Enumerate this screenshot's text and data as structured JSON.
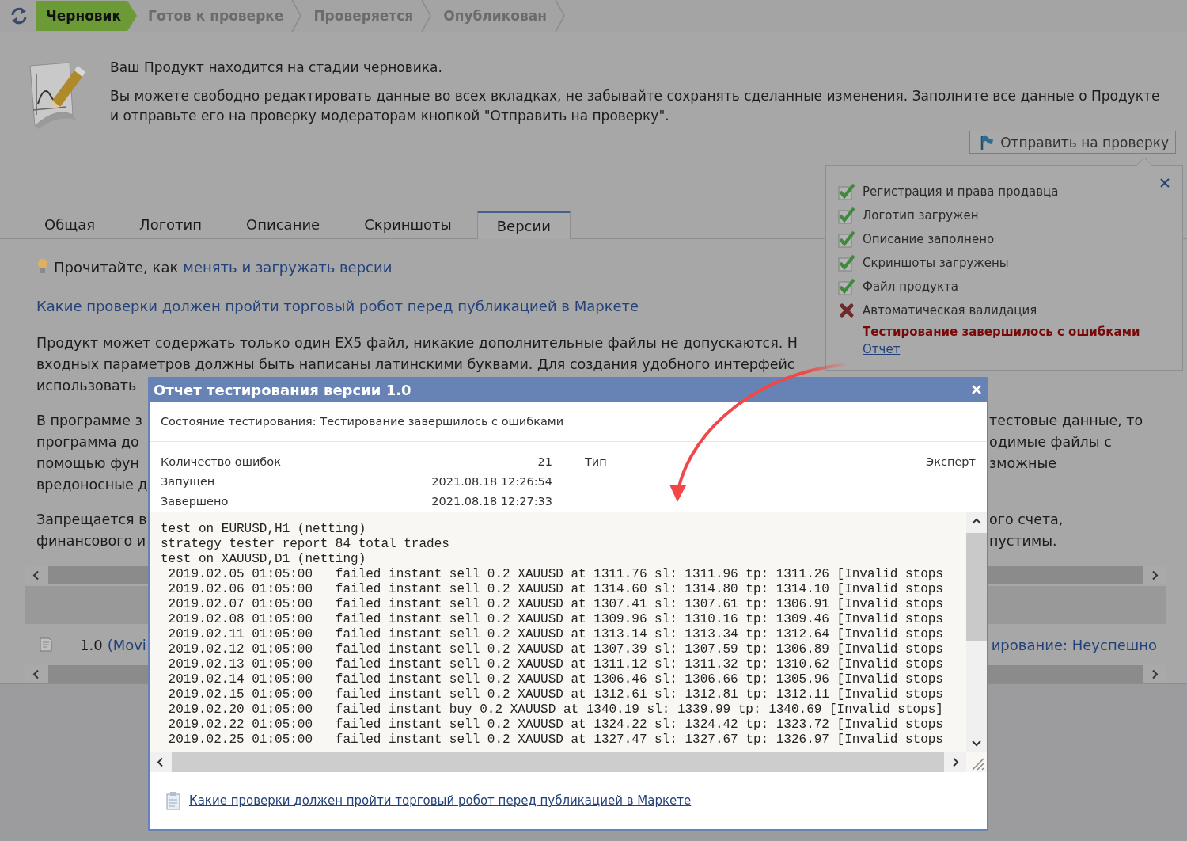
{
  "status_steps": [
    {
      "label": "Черновик",
      "selected": true
    },
    {
      "label": "Готов к проверке",
      "selected": false
    },
    {
      "label": "Проверяется",
      "selected": false
    },
    {
      "label": "Опубликован",
      "selected": false
    }
  ],
  "notice": {
    "title": "Ваш Продукт находится на стадии черновика.",
    "text": "Вы можете свободно редактировать данные во всех вкладках, не забывайте сохранять сделанные изменения. Заполните все данные о Продукте и отправьте его на проверку модераторам кнопкой \"Отправить на проверку\".",
    "button": "Отправить на проверку"
  },
  "tabs": [
    {
      "label": "Общая",
      "selected": false
    },
    {
      "label": "Логотип",
      "selected": false
    },
    {
      "label": "Описание",
      "selected": false
    },
    {
      "label": "Скриншоты",
      "selected": false
    },
    {
      "label": "Версии",
      "selected": true
    }
  ],
  "versions": {
    "tip": {
      "text": "Прочитайте, как",
      "link": "менять и загружать версии"
    },
    "checks_link": "Какие проверки должен пройти торговый робот перед публикацией в Маркете",
    "paragraphs": [
      [
        {
          "left": "Продукт может содержать только один EX5 файл, никакие дополнительные файлы не допускаются. Н"
        },
        {
          "left": "входных параметров должны быть написаны латинскими буквами. Для создания удобного интерфейс"
        },
        {
          "left": "использовать"
        }
      ],
      [
        {
          "left": "В программе з",
          "right": "тестовые данные, то"
        },
        {
          "left": "программа до",
          "right": "одимые файлы с"
        },
        {
          "left": "помощью фун",
          "right": "зможные"
        },
        {
          "left": "вредоносные д"
        }
      ],
      [
        {
          "left": "Запрещается в",
          "right": "ого счета,"
        },
        {
          "left": "финансового и",
          "right": "пустимы."
        }
      ]
    ],
    "version_row": {
      "number": "1.0",
      "link": "(Movi",
      "status": "ирование: Неуспешно"
    }
  },
  "checklist": {
    "items": [
      {
        "label": "Регистрация и права продавца",
        "passed": true
      },
      {
        "label": "Логотип загружен",
        "passed": true
      },
      {
        "label": "Описание заполнено",
        "passed": true
      },
      {
        "label": "Скриншоты загружены",
        "passed": true
      },
      {
        "label": "Файл продукта",
        "passed": true
      },
      {
        "label": "Автоматическая валидация",
        "passed": false
      }
    ],
    "error": "Тестирование завершилось с ошибками",
    "report_link": "Отчет"
  },
  "report_dialog": {
    "title": "Отчет тестирования версии 1.0",
    "status": "Состояние тестирования: Тестирование завершилось с ошибками",
    "stats": [
      {
        "label": "Количество ошибок",
        "value": "21"
      },
      {
        "label": "Запущен",
        "value": "2021.08.18 12:26:54"
      },
      {
        "label": "Завершено",
        "value": "2021.08.18 12:27:33"
      }
    ],
    "type": {
      "label": "Тип",
      "value": "Эксперт"
    },
    "log": [
      "test on EURUSD,H1 (netting)",
      "strategy tester report 84 total trades",
      "test on XAUUSD,D1 (netting)",
      " 2019.02.05 01:05:00   failed instant sell 0.2 XAUUSD at 1311.76 sl: 1311.96 tp: 1311.26 [Invalid stops",
      " 2019.02.06 01:05:00   failed instant sell 0.2 XAUUSD at 1314.60 sl: 1314.80 tp: 1314.10 [Invalid stops",
      " 2019.02.07 01:05:00   failed instant sell 0.2 XAUUSD at 1307.41 sl: 1307.61 tp: 1306.91 [Invalid stops",
      " 2019.02.08 01:05:00   failed instant sell 0.2 XAUUSD at 1309.96 sl: 1310.16 tp: 1309.46 [Invalid stops",
      " 2019.02.11 01:05:00   failed instant sell 0.2 XAUUSD at 1313.14 sl: 1313.34 tp: 1312.64 [Invalid stops",
      " 2019.02.12 01:05:00   failed instant sell 0.2 XAUUSD at 1307.39 sl: 1307.59 tp: 1306.89 [Invalid stops",
      " 2019.02.13 01:05:00   failed instant sell 0.2 XAUUSD at 1311.12 sl: 1311.32 tp: 1310.62 [Invalid stops",
      " 2019.02.14 01:05:00   failed instant sell 0.2 XAUUSD at 1306.46 sl: 1306.66 tp: 1305.96 [Invalid stops",
      " 2019.02.15 01:05:00   failed instant sell 0.2 XAUUSD at 1312.61 sl: 1312.81 tp: 1312.11 [Invalid stops",
      " 2019.02.20 01:05:00   failed instant buy 0.2 XAUUSD at 1340.19 sl: 1339.99 tp: 1340.69 [Invalid stops]",
      " 2019.02.22 01:05:00   failed instant sell 0.2 XAUUSD at 1324.22 sl: 1324.42 tp: 1323.72 [Invalid stops",
      " 2019.02.25 01:05:00   failed instant sell 0.2 XAUUSD at 1327.47 sl: 1327.67 tp: 1326.97 [Invalid stops"
    ],
    "footer_link": "Какие проверки должен пройти торговый робот перед публикацией в Маркете"
  }
}
